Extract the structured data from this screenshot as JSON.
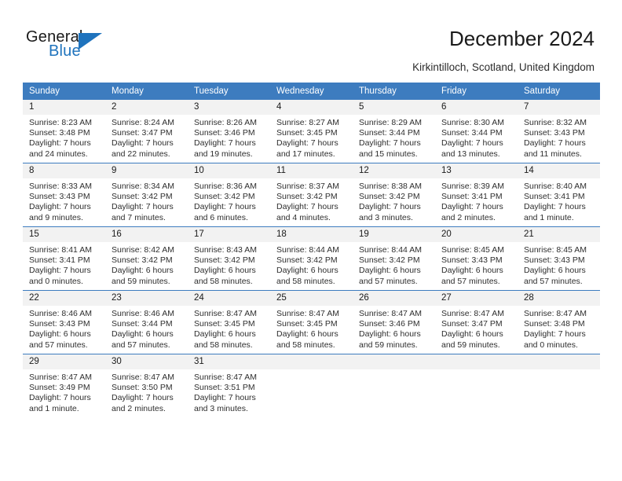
{
  "logo": {
    "word1": "General",
    "word2": "Blue",
    "triangle_color": "#1f73bd"
  },
  "header": {
    "title": "December 2024",
    "subtitle": "Kirkintilloch, Scotland, United Kingdom",
    "header_bg": "#3d7cbf",
    "daynum_bg": "#f2f2f2"
  },
  "weekdays": [
    "Sunday",
    "Monday",
    "Tuesday",
    "Wednesday",
    "Thursday",
    "Friday",
    "Saturday"
  ],
  "weeks": [
    [
      {
        "day": "1",
        "sunrise": "Sunrise: 8:23 AM",
        "sunset": "Sunset: 3:48 PM",
        "daylight1": "Daylight: 7 hours",
        "daylight2": "and 24 minutes."
      },
      {
        "day": "2",
        "sunrise": "Sunrise: 8:24 AM",
        "sunset": "Sunset: 3:47 PM",
        "daylight1": "Daylight: 7 hours",
        "daylight2": "and 22 minutes."
      },
      {
        "day": "3",
        "sunrise": "Sunrise: 8:26 AM",
        "sunset": "Sunset: 3:46 PM",
        "daylight1": "Daylight: 7 hours",
        "daylight2": "and 19 minutes."
      },
      {
        "day": "4",
        "sunrise": "Sunrise: 8:27 AM",
        "sunset": "Sunset: 3:45 PM",
        "daylight1": "Daylight: 7 hours",
        "daylight2": "and 17 minutes."
      },
      {
        "day": "5",
        "sunrise": "Sunrise: 8:29 AM",
        "sunset": "Sunset: 3:44 PM",
        "daylight1": "Daylight: 7 hours",
        "daylight2": "and 15 minutes."
      },
      {
        "day": "6",
        "sunrise": "Sunrise: 8:30 AM",
        "sunset": "Sunset: 3:44 PM",
        "daylight1": "Daylight: 7 hours",
        "daylight2": "and 13 minutes."
      },
      {
        "day": "7",
        "sunrise": "Sunrise: 8:32 AM",
        "sunset": "Sunset: 3:43 PM",
        "daylight1": "Daylight: 7 hours",
        "daylight2": "and 11 minutes."
      }
    ],
    [
      {
        "day": "8",
        "sunrise": "Sunrise: 8:33 AM",
        "sunset": "Sunset: 3:43 PM",
        "daylight1": "Daylight: 7 hours",
        "daylight2": "and 9 minutes."
      },
      {
        "day": "9",
        "sunrise": "Sunrise: 8:34 AM",
        "sunset": "Sunset: 3:42 PM",
        "daylight1": "Daylight: 7 hours",
        "daylight2": "and 7 minutes."
      },
      {
        "day": "10",
        "sunrise": "Sunrise: 8:36 AM",
        "sunset": "Sunset: 3:42 PM",
        "daylight1": "Daylight: 7 hours",
        "daylight2": "and 6 minutes."
      },
      {
        "day": "11",
        "sunrise": "Sunrise: 8:37 AM",
        "sunset": "Sunset: 3:42 PM",
        "daylight1": "Daylight: 7 hours",
        "daylight2": "and 4 minutes."
      },
      {
        "day": "12",
        "sunrise": "Sunrise: 8:38 AM",
        "sunset": "Sunset: 3:42 PM",
        "daylight1": "Daylight: 7 hours",
        "daylight2": "and 3 minutes."
      },
      {
        "day": "13",
        "sunrise": "Sunrise: 8:39 AM",
        "sunset": "Sunset: 3:41 PM",
        "daylight1": "Daylight: 7 hours",
        "daylight2": "and 2 minutes."
      },
      {
        "day": "14",
        "sunrise": "Sunrise: 8:40 AM",
        "sunset": "Sunset: 3:41 PM",
        "daylight1": "Daylight: 7 hours",
        "daylight2": "and 1 minute."
      }
    ],
    [
      {
        "day": "15",
        "sunrise": "Sunrise: 8:41 AM",
        "sunset": "Sunset: 3:41 PM",
        "daylight1": "Daylight: 7 hours",
        "daylight2": "and 0 minutes."
      },
      {
        "day": "16",
        "sunrise": "Sunrise: 8:42 AM",
        "sunset": "Sunset: 3:42 PM",
        "daylight1": "Daylight: 6 hours",
        "daylight2": "and 59 minutes."
      },
      {
        "day": "17",
        "sunrise": "Sunrise: 8:43 AM",
        "sunset": "Sunset: 3:42 PM",
        "daylight1": "Daylight: 6 hours",
        "daylight2": "and 58 minutes."
      },
      {
        "day": "18",
        "sunrise": "Sunrise: 8:44 AM",
        "sunset": "Sunset: 3:42 PM",
        "daylight1": "Daylight: 6 hours",
        "daylight2": "and 58 minutes."
      },
      {
        "day": "19",
        "sunrise": "Sunrise: 8:44 AM",
        "sunset": "Sunset: 3:42 PM",
        "daylight1": "Daylight: 6 hours",
        "daylight2": "and 57 minutes."
      },
      {
        "day": "20",
        "sunrise": "Sunrise: 8:45 AM",
        "sunset": "Sunset: 3:43 PM",
        "daylight1": "Daylight: 6 hours",
        "daylight2": "and 57 minutes."
      },
      {
        "day": "21",
        "sunrise": "Sunrise: 8:45 AM",
        "sunset": "Sunset: 3:43 PM",
        "daylight1": "Daylight: 6 hours",
        "daylight2": "and 57 minutes."
      }
    ],
    [
      {
        "day": "22",
        "sunrise": "Sunrise: 8:46 AM",
        "sunset": "Sunset: 3:43 PM",
        "daylight1": "Daylight: 6 hours",
        "daylight2": "and 57 minutes."
      },
      {
        "day": "23",
        "sunrise": "Sunrise: 8:46 AM",
        "sunset": "Sunset: 3:44 PM",
        "daylight1": "Daylight: 6 hours",
        "daylight2": "and 57 minutes."
      },
      {
        "day": "24",
        "sunrise": "Sunrise: 8:47 AM",
        "sunset": "Sunset: 3:45 PM",
        "daylight1": "Daylight: 6 hours",
        "daylight2": "and 58 minutes."
      },
      {
        "day": "25",
        "sunrise": "Sunrise: 8:47 AM",
        "sunset": "Sunset: 3:45 PM",
        "daylight1": "Daylight: 6 hours",
        "daylight2": "and 58 minutes."
      },
      {
        "day": "26",
        "sunrise": "Sunrise: 8:47 AM",
        "sunset": "Sunset: 3:46 PM",
        "daylight1": "Daylight: 6 hours",
        "daylight2": "and 59 minutes."
      },
      {
        "day": "27",
        "sunrise": "Sunrise: 8:47 AM",
        "sunset": "Sunset: 3:47 PM",
        "daylight1": "Daylight: 6 hours",
        "daylight2": "and 59 minutes."
      },
      {
        "day": "28",
        "sunrise": "Sunrise: 8:47 AM",
        "sunset": "Sunset: 3:48 PM",
        "daylight1": "Daylight: 7 hours",
        "daylight2": "and 0 minutes."
      }
    ],
    [
      {
        "day": "29",
        "sunrise": "Sunrise: 8:47 AM",
        "sunset": "Sunset: 3:49 PM",
        "daylight1": "Daylight: 7 hours",
        "daylight2": "and 1 minute."
      },
      {
        "day": "30",
        "sunrise": "Sunrise: 8:47 AM",
        "sunset": "Sunset: 3:50 PM",
        "daylight1": "Daylight: 7 hours",
        "daylight2": "and 2 minutes."
      },
      {
        "day": "31",
        "sunrise": "Sunrise: 8:47 AM",
        "sunset": "Sunset: 3:51 PM",
        "daylight1": "Daylight: 7 hours",
        "daylight2": "and 3 minutes."
      },
      {
        "day": "",
        "sunrise": "",
        "sunset": "",
        "daylight1": "",
        "daylight2": ""
      },
      {
        "day": "",
        "sunrise": "",
        "sunset": "",
        "daylight1": "",
        "daylight2": ""
      },
      {
        "day": "",
        "sunrise": "",
        "sunset": "",
        "daylight1": "",
        "daylight2": ""
      },
      {
        "day": "",
        "sunrise": "",
        "sunset": "",
        "daylight1": "",
        "daylight2": ""
      }
    ]
  ]
}
